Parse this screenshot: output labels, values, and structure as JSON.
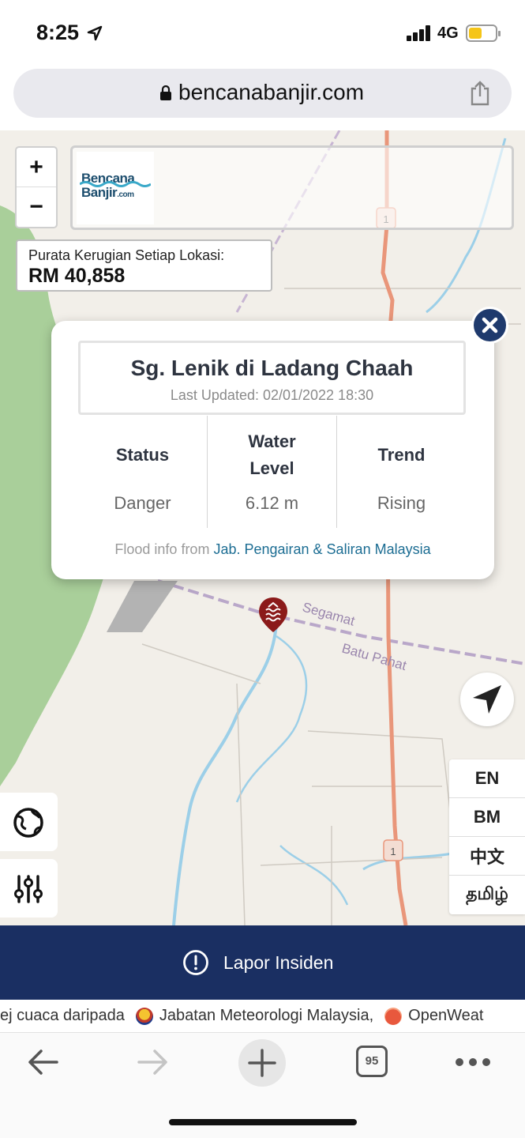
{
  "status_bar": {
    "time": "8:25",
    "network": "4G"
  },
  "browser": {
    "url": "bencanabanjir.com",
    "tab_count": "95"
  },
  "map": {
    "zoom_in_label": "+",
    "zoom_out_label": "−",
    "logo": {
      "line1": "Bencana",
      "line2": "Banjir",
      "suffix": ".com"
    },
    "average_loss": {
      "label": "Purata Kerugian Setiap Lokasi:",
      "value": "RM 40,858"
    },
    "map_labels": {
      "road_number": "1",
      "place_1": "Segamat",
      "place_2": "Batu Pahat"
    },
    "languages": [
      "EN",
      "BM",
      "中文",
      "தமிழ்"
    ]
  },
  "popup": {
    "station": "Sg. Lenik di Ladang Chaah",
    "last_updated": "Last Updated: 02/01/2022 18:30",
    "columns": [
      {
        "head": "Status",
        "value": "Danger"
      },
      {
        "head": "Water Level",
        "value": "6.12 m"
      },
      {
        "head": "Trend",
        "value": "Rising"
      }
    ],
    "source_prefix": "Flood info from ",
    "source_link": "Jab. Pengairan & Saliran Malaysia"
  },
  "report": {
    "label": "Lapor Insiden"
  },
  "ticker": {
    "text_1": "ej cuaca daripada",
    "text_2": "Jabatan Meteorologi Malaysia,",
    "text_3": "OpenWeat"
  },
  "colors": {
    "navy": "#1a2f62",
    "close_button": "#1f3a6d",
    "pin": "#8b1a1a",
    "link": "#1c6d93",
    "forest": "#a9cf9a",
    "river": "#9ccfe8",
    "main_road": "#e9967a"
  }
}
